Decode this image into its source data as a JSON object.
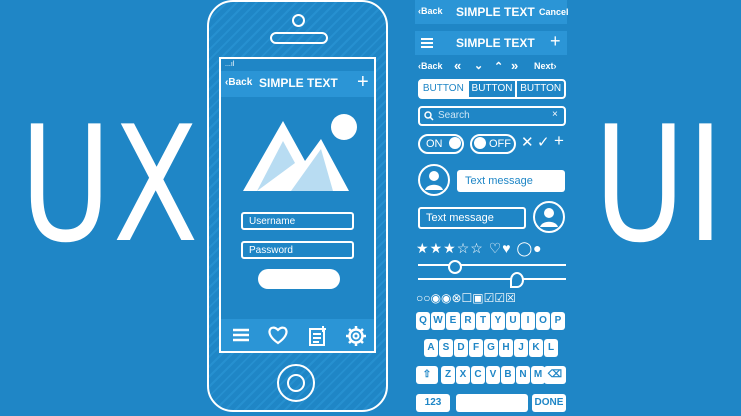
{
  "hero": {
    "left_text": "UX",
    "right_text": "UI"
  },
  "phone": {
    "status": "...ıl",
    "nav": {
      "back_label": "Back",
      "title": "SIMPLE TEXT",
      "add_symbol": "+"
    },
    "form": {
      "username_placeholder": "Username",
      "password_placeholder": "Password"
    },
    "tabbar": [
      "menu-icon",
      "heart-icon",
      "notes-icon",
      "gear-icon"
    ]
  },
  "kit": {
    "topbar": {
      "back_label": "Back",
      "title": "SIMPLE TEXT",
      "cancel_label": "Cancel"
    },
    "menubar": {
      "title": "SIMPLE TEXT",
      "add_symbol": "+"
    },
    "pager": {
      "back_label": "Back",
      "next_label": "Next"
    },
    "segmented": [
      "BUTTON",
      "BUTTON",
      "BUTTON"
    ],
    "search": {
      "placeholder": "Search",
      "clear": "×"
    },
    "toggles": {
      "on_label": "ON",
      "off_label": "OFF"
    },
    "marks": [
      "✕",
      "✓",
      "+"
    ],
    "chat": {
      "incoming": "Text message",
      "outgoing": "Text message"
    },
    "rating": {
      "filled": 3,
      "total": 5
    },
    "keyboard": {
      "row1": [
        "Q",
        "W",
        "E",
        "R",
        "T",
        "Y",
        "U",
        "I",
        "O",
        "P"
      ],
      "row2": [
        "A",
        "S",
        "D",
        "F",
        "G",
        "H",
        "J",
        "K",
        "L"
      ],
      "row3": [
        "Z",
        "X",
        "C",
        "V",
        "B",
        "N",
        "M"
      ],
      "numbers_label": "123",
      "done_label": "DONE"
    },
    "slider": {
      "top_value": 0.28,
      "bottom_value": 0.65
    }
  },
  "colors": {
    "background": "#1f86c6",
    "accent": "#ffffff",
    "bar": "#2b95d6"
  }
}
